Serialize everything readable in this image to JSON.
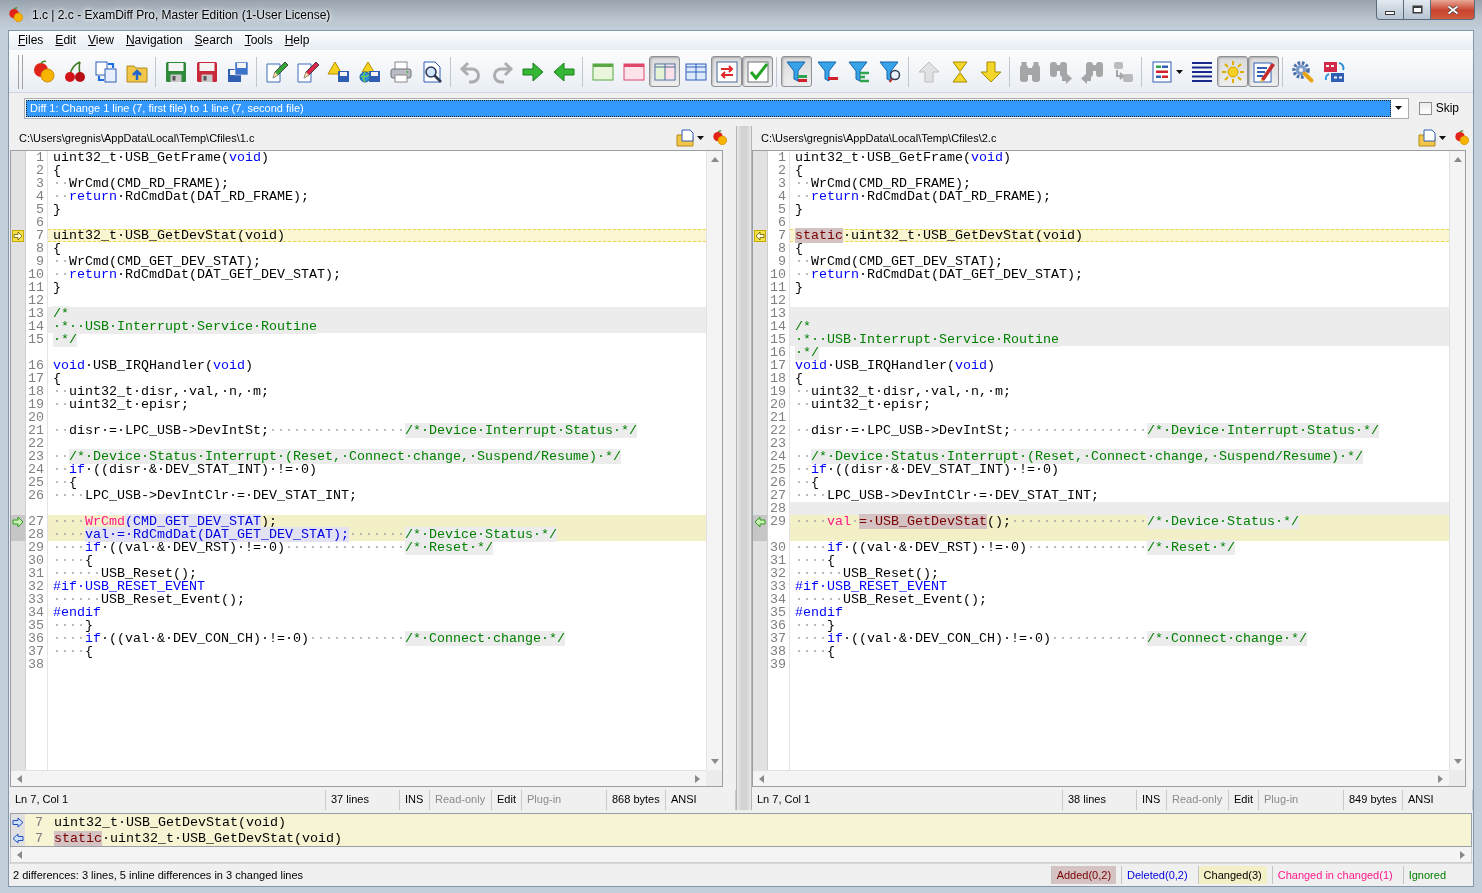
{
  "window": {
    "title": "1.c | 2.c - ExamDiff Pro, Master Edition (1-User License)"
  },
  "menu": [
    "Files",
    "Edit",
    "View",
    "Navigation",
    "Search",
    "Tools",
    "Help"
  ],
  "toolbar": [
    [
      {
        "pressed": false,
        "disabled": false
      },
      {
        "pressed": false,
        "disabled": false
      },
      {
        "pressed": false,
        "disabled": false
      },
      {
        "pressed": false,
        "disabled": false
      }
    ],
    [
      {
        "pressed": false,
        "disabled": false
      },
      {
        "pressed": false,
        "disabled": false
      },
      {
        "pressed": false,
        "disabled": false
      }
    ],
    [
      {
        "pressed": false,
        "disabled": false
      },
      {
        "pressed": false,
        "disabled": false
      },
      {
        "pressed": false,
        "disabled": false
      },
      {
        "pressed": false,
        "disabled": false
      },
      {
        "pressed": false,
        "disabled": false
      },
      {
        "pressed": false,
        "disabled": false
      }
    ],
    [
      {
        "pressed": false,
        "disabled": true
      },
      {
        "pressed": false,
        "disabled": true
      },
      {
        "pressed": false,
        "disabled": false
      },
      {
        "pressed": false,
        "disabled": false
      }
    ],
    [
      {
        "pressed": false,
        "disabled": false
      },
      {
        "pressed": false,
        "disabled": false
      },
      {
        "pressed": true,
        "disabled": false
      },
      {
        "pressed": false,
        "disabled": false
      },
      {
        "pressed": true,
        "disabled": false
      },
      {
        "pressed": true,
        "disabled": false
      }
    ],
    [
      {
        "pressed": true,
        "disabled": false
      },
      {
        "pressed": false,
        "disabled": false
      },
      {
        "pressed": false,
        "disabled": false
      },
      {
        "pressed": false,
        "disabled": false
      }
    ],
    [
      {
        "pressed": false,
        "disabled": true
      },
      {
        "pressed": false,
        "disabled": false
      },
      {
        "pressed": false,
        "disabled": false
      }
    ],
    [
      {
        "pressed": false,
        "disabled": true
      },
      {
        "pressed": false,
        "disabled": true
      },
      {
        "pressed": false,
        "disabled": true
      },
      {
        "pressed": false,
        "disabled": true
      }
    ],
    [
      {
        "pressed": false,
        "disabled": false
      },
      {
        "pressed": false,
        "disabled": false
      },
      {
        "pressed": true,
        "disabled": false
      },
      {
        "pressed": true,
        "disabled": false
      }
    ],
    [
      {
        "pressed": false,
        "disabled": false
      },
      {
        "pressed": false,
        "disabled": false
      }
    ]
  ],
  "diff_selector": {
    "value": "Diff 1: Change 1 line (7, first file) to 1 line (7, second file)"
  },
  "skip": {
    "label": "Skip",
    "checked": false
  },
  "panes": [
    {
      "path": "C:\\Users\\gregnis\\AppData\\Local\\Temp\\Cfiles\\1.c",
      "rows": [
        {
          "kind": "plain",
          "number": "1",
          "segments": [
            {
              "kind": "plain",
              "text": "uint32_t·USB_GetFrame("
            },
            {
              "kind": "keyword",
              "text": "void"
            },
            {
              "kind": "plain",
              "text": ")"
            }
          ]
        },
        {
          "kind": "plain",
          "number": "2",
          "segments": [
            {
              "kind": "plain",
              "text": "{"
            }
          ]
        },
        {
          "kind": "plain",
          "number": "3",
          "segments": [
            {
              "kind": "whitespace",
              "text": "··"
            },
            {
              "kind": "plain",
              "text": "WrCmd(CMD_RD_FRAME);"
            }
          ]
        },
        {
          "kind": "plain",
          "number": "4",
          "segments": [
            {
              "kind": "whitespace",
              "text": "··"
            },
            {
              "kind": "keyword",
              "text": "return"
            },
            {
              "kind": "plain",
              "text": "·RdCmdDat(DAT_RD_FRAME);"
            }
          ]
        },
        {
          "kind": "plain",
          "number": "5",
          "segments": [
            {
              "kind": "plain",
              "text": "}"
            }
          ]
        },
        {
          "kind": "plain",
          "number": "6"
        },
        {
          "kind": "current",
          "number": "7",
          "segments": [
            {
              "kind": "plain",
              "text": "uint32_t·USB_GetDevStat(void)"
            }
          ]
        },
        {
          "kind": "plain",
          "number": "8",
          "segments": [
            {
              "kind": "plain",
              "text": "{"
            }
          ]
        },
        {
          "kind": "plain",
          "number": "9",
          "segments": [
            {
              "kind": "whitespace",
              "text": "··"
            },
            {
              "kind": "plain",
              "text": "WrCmd(CMD_GET_DEV_STAT);"
            }
          ]
        },
        {
          "kind": "plain",
          "number": "10",
          "segments": [
            {
              "kind": "whitespace",
              "text": "··"
            },
            {
              "kind": "keyword",
              "text": "return"
            },
            {
              "kind": "plain",
              "text": "·RdCmdDat(DAT_GET_DEV_STAT);"
            }
          ]
        },
        {
          "kind": "plain",
          "number": "11",
          "segments": [
            {
              "kind": "plain",
              "text": "}"
            }
          ]
        },
        {
          "kind": "plain",
          "number": "12"
        },
        {
          "kind": "ignored",
          "number": "13",
          "segments": [
            {
              "kind": "comment",
              "text": "/*"
            }
          ]
        },
        {
          "kind": "ignored",
          "number": "14",
          "segments": [
            {
              "kind": "comment",
              "text": "·*··USB·Interrupt·Service·Routine"
            }
          ]
        },
        {
          "kind": "plain",
          "number": "15",
          "segments": [
            {
              "kind": "comment",
              "text": "·*/"
            }
          ]
        },
        {
          "kind": "plain"
        },
        {
          "kind": "plain",
          "number": "16",
          "segments": [
            {
              "kind": "keyword",
              "text": "void"
            },
            {
              "kind": "plain",
              "text": "·USB_IRQHandler("
            },
            {
              "kind": "keyword",
              "text": "void"
            },
            {
              "kind": "plain",
              "text": ")"
            }
          ]
        },
        {
          "kind": "plain",
          "number": "17",
          "segments": [
            {
              "kind": "plain",
              "text": "{"
            }
          ]
        },
        {
          "kind": "plain",
          "number": "18",
          "segments": [
            {
              "kind": "whitespace",
              "text": "··"
            },
            {
              "kind": "plain",
              "text": "uint32_t·disr,·val,·n,·m;"
            }
          ]
        },
        {
          "kind": "plain",
          "number": "19",
          "segments": [
            {
              "kind": "whitespace",
              "text": "··"
            },
            {
              "kind": "plain",
              "text": "uint32_t·episr;"
            }
          ]
        },
        {
          "kind": "plain",
          "number": "20"
        },
        {
          "kind": "plain",
          "number": "21",
          "segments": [
            {
              "kind": "whitespace",
              "text": "··"
            },
            {
              "kind": "plain",
              "text": "disr·=·LPC_USB->DevIntSt;"
            },
            {
              "kind": "whitespace",
              "text": "·················"
            },
            {
              "kind": "comment",
              "text": "/*·Device·Interrupt·Status·*/"
            }
          ]
        },
        {
          "kind": "plain",
          "number": "22"
        },
        {
          "kind": "plain",
          "number": "23",
          "segments": [
            {
              "kind": "whitespace",
              "text": "··"
            },
            {
              "kind": "comment",
              "text": "/*·Device·Status·Interrupt·(Reset,·Connect·change,·Suspend/Resume)·*/"
            }
          ]
        },
        {
          "kind": "plain",
          "number": "24",
          "segments": [
            {
              "kind": "whitespace",
              "text": "··"
            },
            {
              "kind": "keyword",
              "text": "if"
            },
            {
              "kind": "plain",
              "text": "·((disr·&·DEV_STAT_INT)·!=·0)"
            }
          ]
        },
        {
          "kind": "plain",
          "number": "25",
          "segments": [
            {
              "kind": "whitespace",
              "text": "··"
            },
            {
              "kind": "plain",
              "text": "{"
            }
          ]
        },
        {
          "kind": "plain",
          "number": "26",
          "segments": [
            {
              "kind": "whitespace",
              "text": "····"
            },
            {
              "kind": "plain",
              "text": "LPC_USB->DevIntClr·=·DEV_STAT_INT;"
            }
          ]
        },
        {
          "kind": "plain"
        },
        {
          "kind": "changed",
          "number": "27",
          "segments": [
            {
              "kind": "whitespace",
              "text": "····"
            },
            {
              "kind": "changed_in_changed",
              "text": "WrCmd"
            },
            {
              "kind": "deleted",
              "text": "(CMD_GET_DEV_STAT"
            },
            {
              "kind": "plain",
              "text": ");"
            }
          ]
        },
        {
          "kind": "changed",
          "number": "28",
          "segments": [
            {
              "kind": "whitespace",
              "text": "····"
            },
            {
              "kind": "deleted",
              "text": "val·=·RdCmdDat(DAT_GET_DEV_STAT);"
            },
            {
              "kind": "whitespace",
              "text": "·······"
            },
            {
              "kind": "comment",
              "text": "/*·Device·Status·*/"
            }
          ]
        },
        {
          "kind": "plain",
          "number": "29",
          "segments": [
            {
              "kind": "whitespace",
              "text": "····"
            },
            {
              "kind": "keyword",
              "text": "if"
            },
            {
              "kind": "plain",
              "text": "·((val·&·DEV_RST)·!=·0)"
            },
            {
              "kind": "whitespace",
              "text": "···············"
            },
            {
              "kind": "comment",
              "text": "/*·Reset·*/"
            }
          ]
        },
        {
          "kind": "plain",
          "number": "30",
          "segments": [
            {
              "kind": "whitespace",
              "text": "····"
            },
            {
              "kind": "plain",
              "text": "{"
            }
          ]
        },
        {
          "kind": "plain",
          "number": "31",
          "segments": [
            {
              "kind": "whitespace",
              "text": "······"
            },
            {
              "kind": "plain",
              "text": "USB_Reset();"
            }
          ]
        },
        {
          "kind": "plain",
          "number": "32",
          "segments": [
            {
              "kind": "keyword",
              "text": "#if·USB_RESET_EVENT"
            }
          ]
        },
        {
          "kind": "plain",
          "number": "33",
          "segments": [
            {
              "kind": "whitespace",
              "text": "······"
            },
            {
              "kind": "plain",
              "text": "USB_Reset_Event();"
            }
          ]
        },
        {
          "kind": "plain",
          "number": "34",
          "segments": [
            {
              "kind": "keyword",
              "text": "#endif"
            }
          ]
        },
        {
          "kind": "plain",
          "number": "35",
          "segments": [
            {
              "kind": "whitespace",
              "text": "····"
            },
            {
              "kind": "plain",
              "text": "}"
            }
          ]
        },
        {
          "kind": "plain",
          "number": "36",
          "segments": [
            {
              "kind": "whitespace",
              "text": "····"
            },
            {
              "kind": "keyword",
              "text": "if"
            },
            {
              "kind": "plain",
              "text": "·((val·&·DEV_CON_CH)·!=·0)"
            },
            {
              "kind": "whitespace",
              "text": "············"
            },
            {
              "kind": "comment",
              "text": "/*·Connect·change·*/"
            }
          ]
        },
        {
          "kind": "plain",
          "number": "37",
          "segments": [
            {
              "kind": "whitespace",
              "text": "····"
            },
            {
              "kind": "plain",
              "text": "{"
            }
          ]
        },
        {
          "kind": "plain",
          "number": "38"
        }
      ],
      "status": [
        {
          "text": "Ln 7, Col 1",
          "disabled": false
        },
        {
          "text": "37 lines",
          "disabled": false
        },
        {
          "text": "INS",
          "disabled": false
        },
        {
          "text": "Read-only",
          "disabled": true
        },
        {
          "text": "Edit",
          "disabled": false
        },
        {
          "text": "Plug-in",
          "disabled": true
        },
        {
          "text": "868 bytes",
          "disabled": false
        },
        {
          "text": "ANSI",
          "disabled": false
        }
      ]
    },
    {
      "path": "C:\\Users\\gregnis\\AppData\\Local\\Temp\\Cfiles\\2.c",
      "rows": [
        {
          "kind": "plain",
          "number": "1",
          "segments": [
            {
              "kind": "plain",
              "text": "uint32_t·USB_GetFrame("
            },
            {
              "kind": "keyword",
              "text": "void"
            },
            {
              "kind": "plain",
              "text": ")"
            }
          ]
        },
        {
          "kind": "plain",
          "number": "2",
          "segments": [
            {
              "kind": "plain",
              "text": "{"
            }
          ]
        },
        {
          "kind": "plain",
          "number": "3",
          "segments": [
            {
              "kind": "whitespace",
              "text": "··"
            },
            {
              "kind": "plain",
              "text": "WrCmd(CMD_RD_FRAME);"
            }
          ]
        },
        {
          "kind": "plain",
          "number": "4",
          "segments": [
            {
              "kind": "whitespace",
              "text": "··"
            },
            {
              "kind": "keyword",
              "text": "return"
            },
            {
              "kind": "plain",
              "text": "·RdCmdDat(DAT_RD_FRAME);"
            }
          ]
        },
        {
          "kind": "plain",
          "number": "5",
          "segments": [
            {
              "kind": "plain",
              "text": "}"
            }
          ]
        },
        {
          "kind": "plain",
          "number": "6"
        },
        {
          "kind": "current",
          "number": "7",
          "segments": [
            {
              "kind": "added",
              "text": "static"
            },
            {
              "kind": "plain",
              "text": "·uint32_t·USB_GetDevStat(void)"
            }
          ]
        },
        {
          "kind": "plain",
          "number": "8",
          "segments": [
            {
              "kind": "plain",
              "text": "{"
            }
          ]
        },
        {
          "kind": "plain",
          "number": "9",
          "segments": [
            {
              "kind": "whitespace",
              "text": "··"
            },
            {
              "kind": "plain",
              "text": "WrCmd(CMD_GET_DEV_STAT);"
            }
          ]
        },
        {
          "kind": "plain",
          "number": "10",
          "segments": [
            {
              "kind": "whitespace",
              "text": "··"
            },
            {
              "kind": "keyword",
              "text": "return"
            },
            {
              "kind": "plain",
              "text": "·RdCmdDat(DAT_GET_DEV_STAT);"
            }
          ]
        },
        {
          "kind": "plain",
          "number": "11",
          "segments": [
            {
              "kind": "plain",
              "text": "}"
            }
          ]
        },
        {
          "kind": "plain",
          "number": "12"
        },
        {
          "kind": "ignored",
          "number": "13"
        },
        {
          "kind": "ignored",
          "number": "14",
          "segments": [
            {
              "kind": "comment",
              "text": "/*"
            }
          ]
        },
        {
          "kind": "ignored",
          "number": "15",
          "segments": [
            {
              "kind": "comment",
              "text": "·*··USB·Interrupt·Service·Routine"
            }
          ]
        },
        {
          "kind": "plain",
          "number": "16",
          "segments": [
            {
              "kind": "comment",
              "text": "·*/"
            }
          ]
        },
        {
          "kind": "plain",
          "number": "17",
          "segments": [
            {
              "kind": "keyword",
              "text": "void"
            },
            {
              "kind": "plain",
              "text": "·USB_IRQHandler("
            },
            {
              "kind": "keyword",
              "text": "void"
            },
            {
              "kind": "plain",
              "text": ")"
            }
          ]
        },
        {
          "kind": "plain",
          "number": "18",
          "segments": [
            {
              "kind": "plain",
              "text": "{"
            }
          ]
        },
        {
          "kind": "plain",
          "number": "19",
          "segments": [
            {
              "kind": "whitespace",
              "text": "··"
            },
            {
              "kind": "plain",
              "text": "uint32_t·disr,·val,·n,·m;"
            }
          ]
        },
        {
          "kind": "plain",
          "number": "20",
          "segments": [
            {
              "kind": "whitespace",
              "text": "··"
            },
            {
              "kind": "plain",
              "text": "uint32_t·episr;"
            }
          ]
        },
        {
          "kind": "plain",
          "number": "21"
        },
        {
          "kind": "plain",
          "number": "22",
          "segments": [
            {
              "kind": "whitespace",
              "text": "··"
            },
            {
              "kind": "plain",
              "text": "disr·=·LPC_USB->DevIntSt;"
            },
            {
              "kind": "whitespace",
              "text": "·················"
            },
            {
              "kind": "comment",
              "text": "/*·Device·Interrupt·Status·*/"
            }
          ]
        },
        {
          "kind": "plain",
          "number": "23"
        },
        {
          "kind": "plain",
          "number": "24",
          "segments": [
            {
              "kind": "whitespace",
              "text": "··"
            },
            {
              "kind": "comment",
              "text": "/*·Device·Status·Interrupt·(Reset,·Connect·change,·Suspend/Resume)·*/"
            }
          ]
        },
        {
          "kind": "plain",
          "number": "25",
          "segments": [
            {
              "kind": "whitespace",
              "text": "··"
            },
            {
              "kind": "keyword",
              "text": "if"
            },
            {
              "kind": "plain",
              "text": "·((disr·&·DEV_STAT_INT)·!=·0)"
            }
          ]
        },
        {
          "kind": "plain",
          "number": "26",
          "segments": [
            {
              "kind": "whitespace",
              "text": "··"
            },
            {
              "kind": "plain",
              "text": "{"
            }
          ]
        },
        {
          "kind": "plain",
          "number": "27",
          "segments": [
            {
              "kind": "whitespace",
              "text": "····"
            },
            {
              "kind": "plain",
              "text": "LPC_USB->DevIntClr·=·DEV_STAT_INT;"
            }
          ]
        },
        {
          "kind": "ignored",
          "number": "28"
        },
        {
          "kind": "changed",
          "number": "29",
          "segments": [
            {
              "kind": "whitespace",
              "text": "····"
            },
            {
              "kind": "changed_in_changed",
              "text": "val"
            },
            {
              "kind": "whitespace",
              "text": "·"
            },
            {
              "kind": "added",
              "text": "=·USB_GetDevStat"
            },
            {
              "kind": "plain",
              "text": "();"
            },
            {
              "kind": "whitespace",
              "text": "·················"
            },
            {
              "kind": "comment",
              "text": "/*·Device·Status·*/"
            }
          ]
        },
        {
          "kind": "changed"
        },
        {
          "kind": "plain",
          "number": "30",
          "segments": [
            {
              "kind": "whitespace",
              "text": "····"
            },
            {
              "kind": "keyword",
              "text": "if"
            },
            {
              "kind": "plain",
              "text": "·((val·&·DEV_RST)·!=·0)"
            },
            {
              "kind": "whitespace",
              "text": "···············"
            },
            {
              "kind": "comment",
              "text": "/*·Reset·*/"
            }
          ]
        },
        {
          "kind": "plain",
          "number": "31",
          "segments": [
            {
              "kind": "whitespace",
              "text": "····"
            },
            {
              "kind": "plain",
              "text": "{"
            }
          ]
        },
        {
          "kind": "plain",
          "number": "32",
          "segments": [
            {
              "kind": "whitespace",
              "text": "······"
            },
            {
              "kind": "plain",
              "text": "USB_Reset();"
            }
          ]
        },
        {
          "kind": "plain",
          "number": "33",
          "segments": [
            {
              "kind": "keyword",
              "text": "#if·USB_RESET_EVENT"
            }
          ]
        },
        {
          "kind": "plain",
          "number": "34",
          "segments": [
            {
              "kind": "whitespace",
              "text": "······"
            },
            {
              "kind": "plain",
              "text": "USB_Reset_Event();"
            }
          ]
        },
        {
          "kind": "plain",
          "number": "35",
          "segments": [
            {
              "kind": "keyword",
              "text": "#endif"
            }
          ]
        },
        {
          "kind": "plain",
          "number": "36",
          "segments": [
            {
              "kind": "whitespace",
              "text": "····"
            },
            {
              "kind": "plain",
              "text": "}"
            }
          ]
        },
        {
          "kind": "plain",
          "number": "37",
          "segments": [
            {
              "kind": "whitespace",
              "text": "····"
            },
            {
              "kind": "keyword",
              "text": "if"
            },
            {
              "kind": "plain",
              "text": "·((val·&·DEV_CON_CH)·!=·0)"
            },
            {
              "kind": "whitespace",
              "text": "············"
            },
            {
              "kind": "comment",
              "text": "/*·Connect·change·*/"
            }
          ]
        },
        {
          "kind": "plain",
          "number": "38",
          "segments": [
            {
              "kind": "whitespace",
              "text": "····"
            },
            {
              "kind": "plain",
              "text": "{"
            }
          ]
        },
        {
          "kind": "plain",
          "number": "39"
        }
      ],
      "status": [
        {
          "text": "Ln 7, Col 1",
          "disabled": false
        },
        {
          "text": "38 lines",
          "disabled": false
        },
        {
          "text": "INS",
          "disabled": false
        },
        {
          "text": "Read-only",
          "disabled": true
        },
        {
          "text": "Edit",
          "disabled": false
        },
        {
          "text": "Plug-in",
          "disabled": true
        },
        {
          "text": "849 bytes",
          "disabled": false
        },
        {
          "text": "ANSI",
          "disabled": false
        }
      ]
    }
  ],
  "diff_lines": [
    {
      "number": "7",
      "segments": [
        {
          "kind": "plain",
          "text": "uint32_t·USB_GetDevStat(void)"
        }
      ]
    },
    {
      "number": "7",
      "segments": [
        {
          "kind": "added",
          "text": "static"
        },
        {
          "kind": "plain",
          "text": "·uint32_t·USB_GetDevStat(void)"
        }
      ]
    }
  ],
  "status_bar": {
    "summary": "2 differences: 3 lines, 5 inline differences in 3 changed lines",
    "legend": [
      {
        "label": "Added(0,2)",
        "kind": "added"
      },
      {
        "label": "Deleted(0,2)",
        "kind": "deleted"
      },
      {
        "label": "Changed(3)",
        "kind": "changed"
      },
      {
        "label": "Changed in changed(1)",
        "kind": "changed_in_changed"
      },
      {
        "label": "Ignored",
        "kind": "ignored"
      }
    ]
  }
}
